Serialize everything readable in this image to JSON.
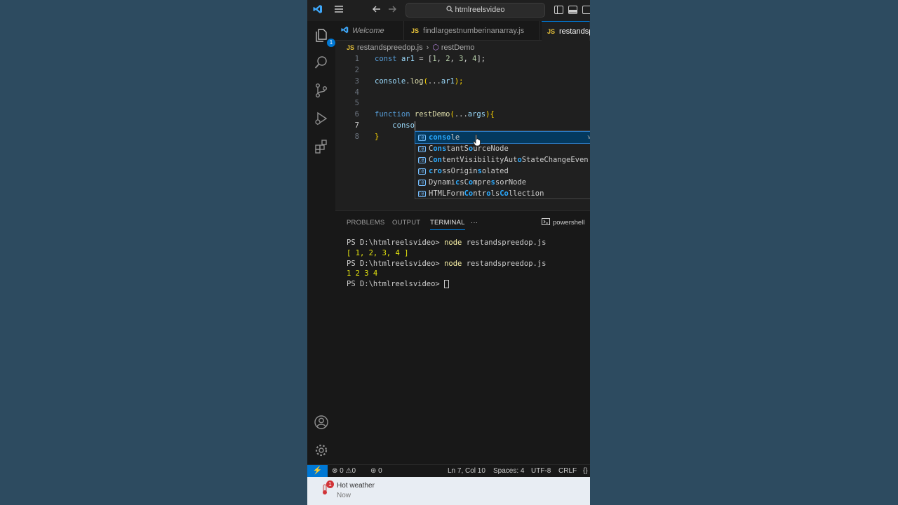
{
  "titlebar": {
    "search_text": "htmlreelsvideo",
    "icons": [
      "vscode-logo-icon",
      "menu-icon",
      "back-arrow-icon",
      "forward-arrow-icon",
      "search-icon",
      "toggle-sidebar-icon",
      "toggle-panel-icon",
      "toggle-secondary-sidebar-icon"
    ]
  },
  "activity": {
    "explorer_badge": "1",
    "icons": [
      "explorer-icon",
      "search-icon",
      "source-control-icon",
      "run-debug-icon",
      "extensions-icon",
      "account-icon",
      "settings-gear-icon"
    ]
  },
  "tabs": [
    {
      "label": "Welcome",
      "active": false
    },
    {
      "label": "findlargestnumberinanarray.js",
      "active": false
    },
    {
      "label": "restandsp",
      "active": true
    }
  ],
  "tab_js_badge": "JS",
  "breadcrumb": {
    "file": "restandspreedop.js",
    "symbol": "restDemo"
  },
  "editor": {
    "line_numbers": [
      "1",
      "2",
      "3",
      "4",
      "5",
      "6",
      "7",
      "8"
    ],
    "current_line": "7",
    "line1": {
      "kw": "const",
      "name": "ar1",
      "eq": " = [",
      "n1": "1",
      "n2": "2",
      "n3": "3",
      "n4": "4",
      "end": "];"
    },
    "line3": {
      "obj": "console",
      "dot": ".",
      "method": "log",
      "open": "(",
      "spread": "...",
      "arg": "ar1",
      "close": ");"
    },
    "line6": {
      "kw": "function",
      "name": "restDemo",
      "open": "(",
      "spread": "...",
      "param": "args",
      "close": ")",
      "brace": "{"
    },
    "line7": {
      "typed": "conso"
    },
    "line8": {
      "brace": "}"
    }
  },
  "suggest": {
    "selected_detail": "va",
    "items": [
      {
        "pre": "",
        "match": "conso",
        "post": "le"
      },
      {
        "pre": "C",
        "match": "ons",
        "post": "tantS",
        "match2": "o",
        "post2": "urceNode"
      },
      {
        "pre": "C",
        "match": "on",
        "post": "tentVisibilityAut",
        "match2": "o",
        "post2": "StateChangeEven"
      },
      {
        "pre": "",
        "match": "c",
        "post": "r",
        "match2": "o",
        "post2": "ssOrigin",
        "match3": "s",
        "post3": "olated"
      },
      {
        "pre": "Dynami",
        "match": "c",
        "post": "sC",
        "match2": "o",
        "post2": "mpre",
        "match3": "s",
        "post3": "sorNode"
      },
      {
        "pre": "HTMLForm",
        "match": "Co",
        "post": "ntr",
        "match2": "o",
        "post2": "ls",
        "match3": "Co",
        "post3": "llection"
      }
    ]
  },
  "panel": {
    "tabs": [
      "PROBLEMS",
      "OUTPUT",
      "TERMINAL"
    ],
    "active_tab": "TERMINAL",
    "more": "···",
    "shell": "powershell"
  },
  "terminal": {
    "prompt": "PS D:\\htmlreelsvideo> ",
    "cmd1": "node",
    "args1": " restandspreedop.js",
    "out1": "[ 1, 2, 3, 4 ]",
    "cmd2": "node",
    "args2": " restandspreedop.js",
    "out2": "1 2 3 4"
  },
  "statusbar": {
    "errors": "0",
    "warnings": "0",
    "ports": "0",
    "position": "Ln 7, Col 10",
    "spaces": "Spaces: 4",
    "encoding": "UTF-8",
    "eol": "CRLF",
    "lang": "{}"
  },
  "notification": {
    "title": "Hot weather",
    "time": "Now",
    "badge": "1"
  },
  "colors": {
    "accent": "#0078d4",
    "keyword": "#569cd6",
    "variable": "#9cdcfe",
    "function": "#dcdcaa",
    "number": "#b5cea8",
    "match": "#2aaaff",
    "js_badge": "#e8c33a"
  }
}
